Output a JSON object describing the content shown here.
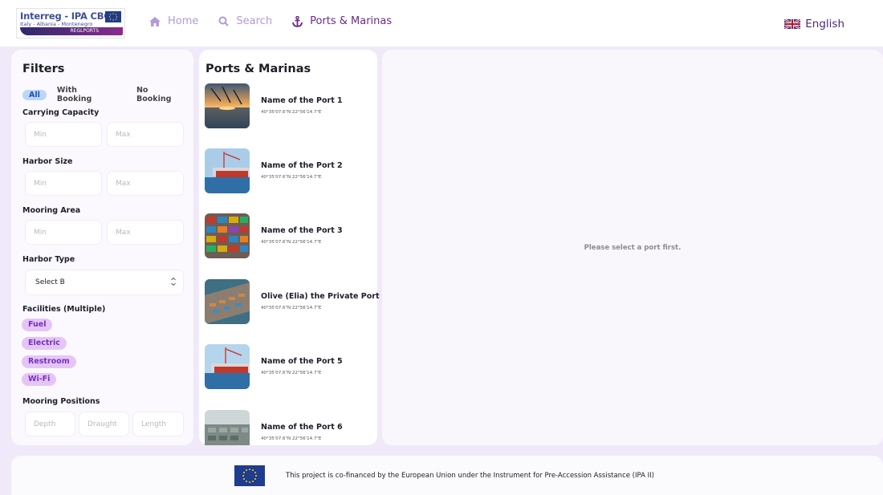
{
  "header": {
    "logo": {
      "title": "Interreg - IPA CBC",
      "subtitle": "Italy - Albania - Montenegro",
      "project": "REGLPORTS"
    },
    "nav": [
      {
        "label": "Home",
        "icon": "home-icon"
      },
      {
        "label": "Search",
        "icon": "search-icon"
      },
      {
        "label": "Ports & Marinas",
        "icon": "anchor-icon",
        "active": true
      }
    ],
    "language": "English"
  },
  "filters": {
    "title": "Filters",
    "booking_options": [
      "All",
      "With Booking",
      "No Booking"
    ],
    "selected_booking": "All",
    "carrying_capacity": {
      "label": "Carrying Capacity",
      "min_placeholder": "Min",
      "max_placeholder": "Max"
    },
    "harbor_size": {
      "label": "Harbor Size",
      "min_placeholder": "Min",
      "max_placeholder": "Max"
    },
    "mooring_area": {
      "label": "Mooring Area",
      "min_placeholder": "Min",
      "max_placeholder": "Max"
    },
    "harbor_type": {
      "label": "Harbor Type",
      "selected": "Select B"
    },
    "facilities": {
      "label": "Facilities (Multiple)",
      "items": [
        "Fuel",
        "Electric",
        "Restroom",
        "Wi-Fi"
      ]
    },
    "mooring_positions": {
      "label": "Mooring Positions",
      "depth_placeholder": "Depth",
      "draught_placeholder": "Draught",
      "length_placeholder": "Length"
    }
  },
  "ports": {
    "title": "Ports & Marinas",
    "items": [
      {
        "name": "Name of the Port 1",
        "coords": "40°35'07.6\"N 22°56'14.7\"E"
      },
      {
        "name": "Name of the Port 2",
        "coords": "40°35'07.6\"N 22°56'14.7\"E"
      },
      {
        "name": "Name of the Port 3",
        "coords": "40°35'07.6\"N 22°56'14.7\"E"
      },
      {
        "name": "Olive (Elia) the Private Port",
        "coords": "40°35'07.6\"N 22°56'14.7\"E"
      },
      {
        "name": "Name of the Port 5",
        "coords": "40°35'07.6\"N 22°56'14.7\"E"
      },
      {
        "name": "Name of the Port 6",
        "coords": "40°35'07.6\"N 22°56'14.7\"E"
      }
    ]
  },
  "detail": {
    "empty_message": "Please select a port first."
  },
  "footer": {
    "text": "This project is co-financed by the European Union under the Instrument for Pre-Accession Assistance (IPA II)"
  },
  "colors": {
    "accent": "#6a2b84",
    "nav_inactive": "#b39ad6",
    "chip_bg": "#e4c6f6",
    "chip_text": "#7a2ec4",
    "page_bg": "#efe9f9"
  }
}
